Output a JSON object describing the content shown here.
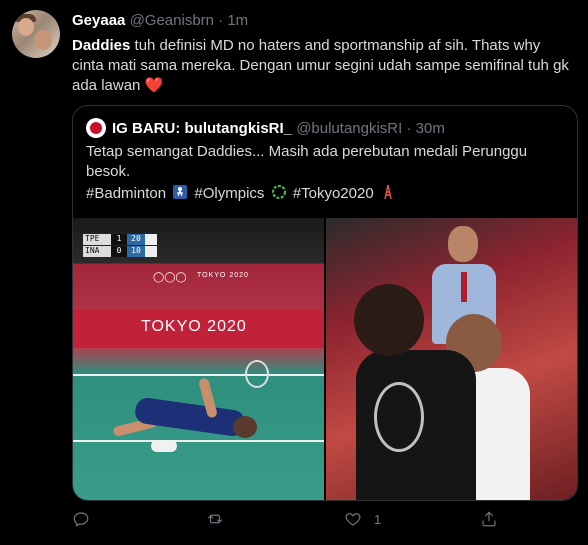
{
  "tweet": {
    "author_name": "Geyaaa",
    "author_handle": "@Geanisbrn",
    "separator": "·",
    "time": "1m",
    "text_bold": "Daddies",
    "text_rest": " tuh definisi MD no haters and sportmanship af sih. Thats why cinta mati sama mereka. Dengan umur segini udah sampe semifinal tuh gk ada lawan",
    "heart_emoji": "❤️"
  },
  "quoted": {
    "author_name": "IG BARU: bulutangkisRI_",
    "author_handle": "@bulutangkisRI",
    "separator": "·",
    "time": "30m",
    "text": "Tetap semangat Daddies... Masih ada perebutan medali Perunggu besok.",
    "hashtag_1": "#Badminton",
    "hashtag_2": "#Olympics",
    "hashtag_3": "#Tokyo2020",
    "images": {
      "left": {
        "scoreboard": [
          {
            "team": "TPE",
            "games": "1",
            "points": "20"
          },
          {
            "team": "INA",
            "games": "0",
            "points": "10"
          }
        ],
        "board_label_small": "TOKYO 2020",
        "board_label": "TOKYO 2020"
      }
    }
  },
  "actions": {
    "reply_count": "",
    "retweet_count": "",
    "like_count": "1",
    "share_count": ""
  },
  "colors": {
    "background": "#000000",
    "text": "#d9d9d9",
    "muted": "#6e767d",
    "border": "#2f3336",
    "heart": "#e0245e"
  }
}
